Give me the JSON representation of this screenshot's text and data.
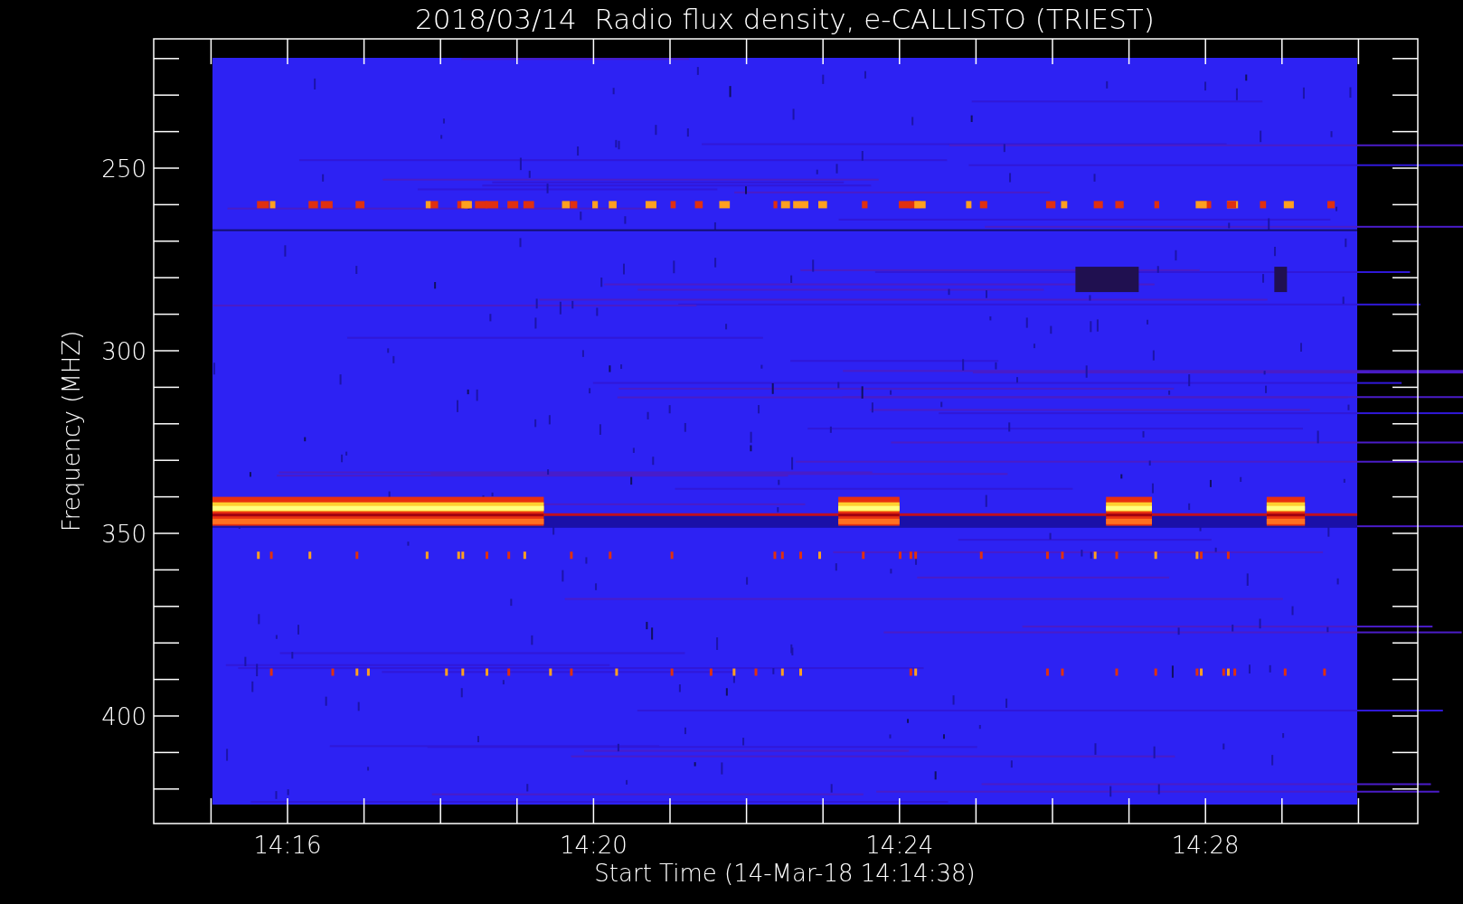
{
  "title": "2018/03/14  Radio flux density, e-CALLISTO (TRIEST)",
  "y_axis": {
    "label": "Frequency (MHZ)",
    "ticks": [
      "250",
      "300",
      "350",
      "400"
    ]
  },
  "x_axis": {
    "label": "Start Time (14-Mar-18 14:14:38)",
    "ticks": [
      "14:16",
      "14:20",
      "14:24",
      "14:28"
    ]
  }
}
